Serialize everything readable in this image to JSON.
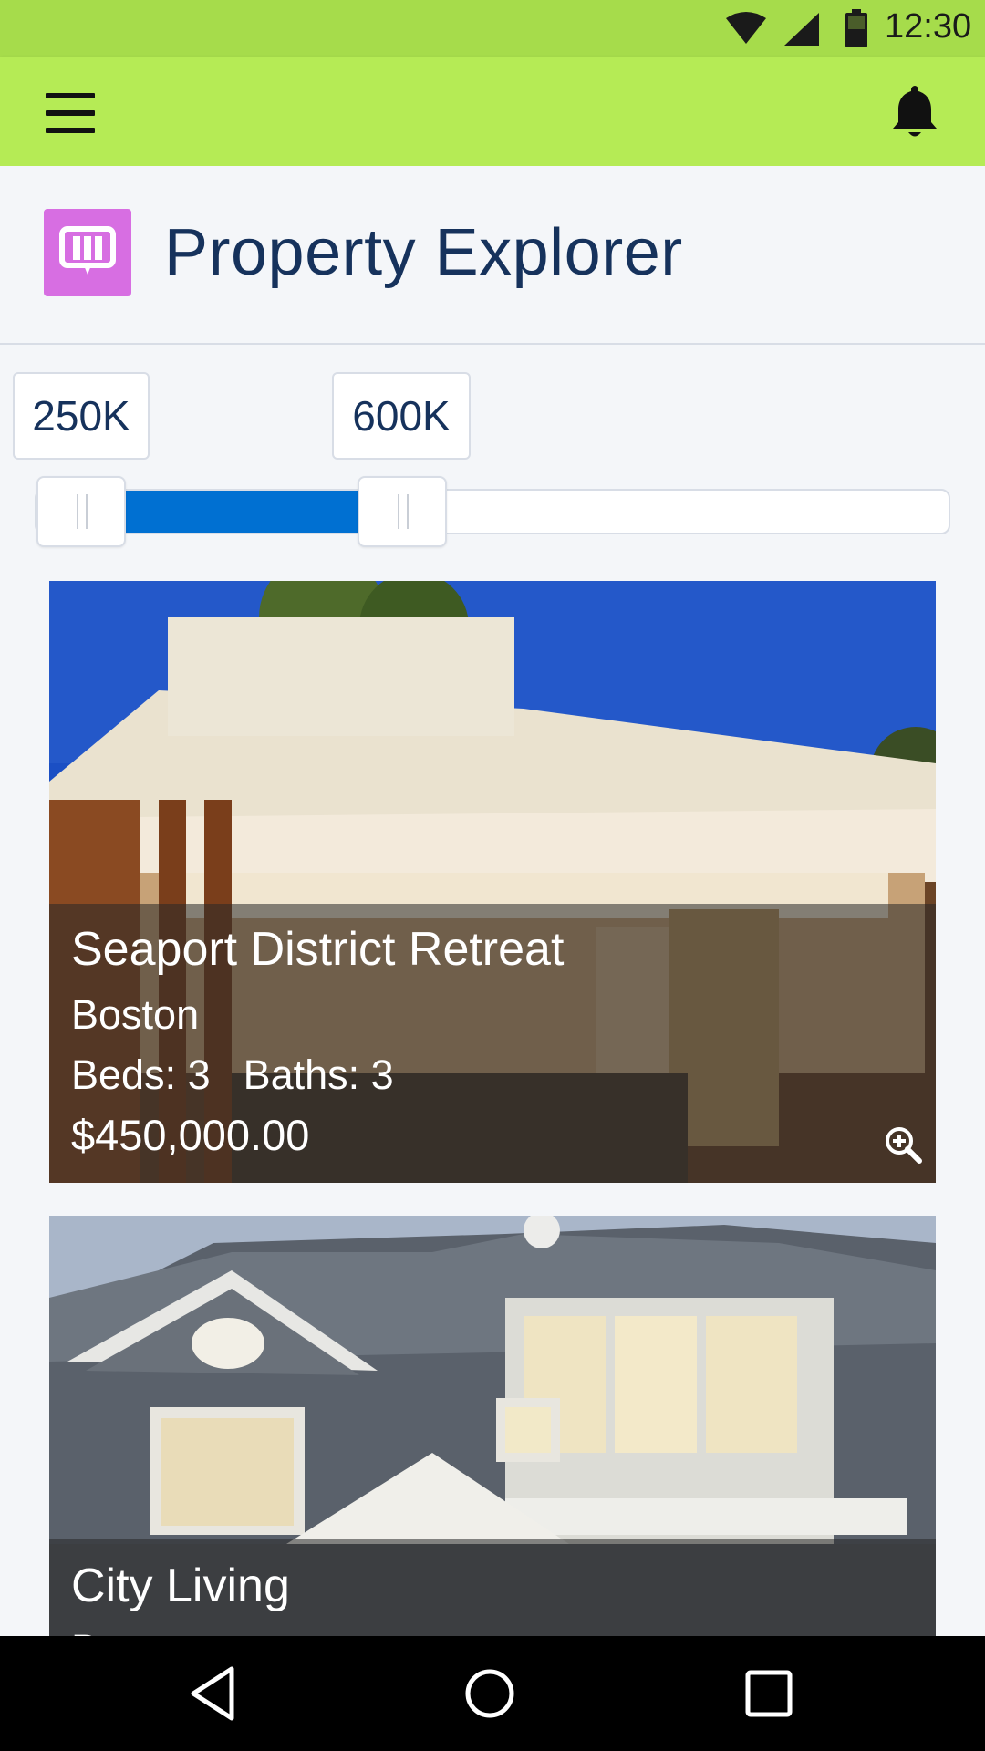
{
  "status_bar": {
    "time": "12:30",
    "icons": [
      "wifi-icon",
      "cell-signal-icon",
      "battery-icon"
    ]
  },
  "app_bar": {
    "menu_icon": "hamburger-menu-icon",
    "notification_icon": "bell-icon",
    "background": "#b5eb55"
  },
  "header": {
    "title": "Property Explorer",
    "icon": "property-explorer-icon",
    "icon_color": "#d76ee2",
    "title_color": "#16325c"
  },
  "price_filter": {
    "min_label": "250K",
    "max_label": "600K",
    "fill_color": "#0070d2"
  },
  "properties": [
    {
      "title": "Seaport District Retreat",
      "city": "Boston",
      "beds_label": "Beds: 3",
      "baths_label": "Baths: 3",
      "price": "$450,000.00",
      "zoom_icon": "zoom-in-icon"
    },
    {
      "title": "City Living",
      "city": "Boston"
    }
  ],
  "nav_bar": {
    "buttons": [
      "back-icon",
      "home-icon",
      "recent-apps-icon"
    ]
  }
}
